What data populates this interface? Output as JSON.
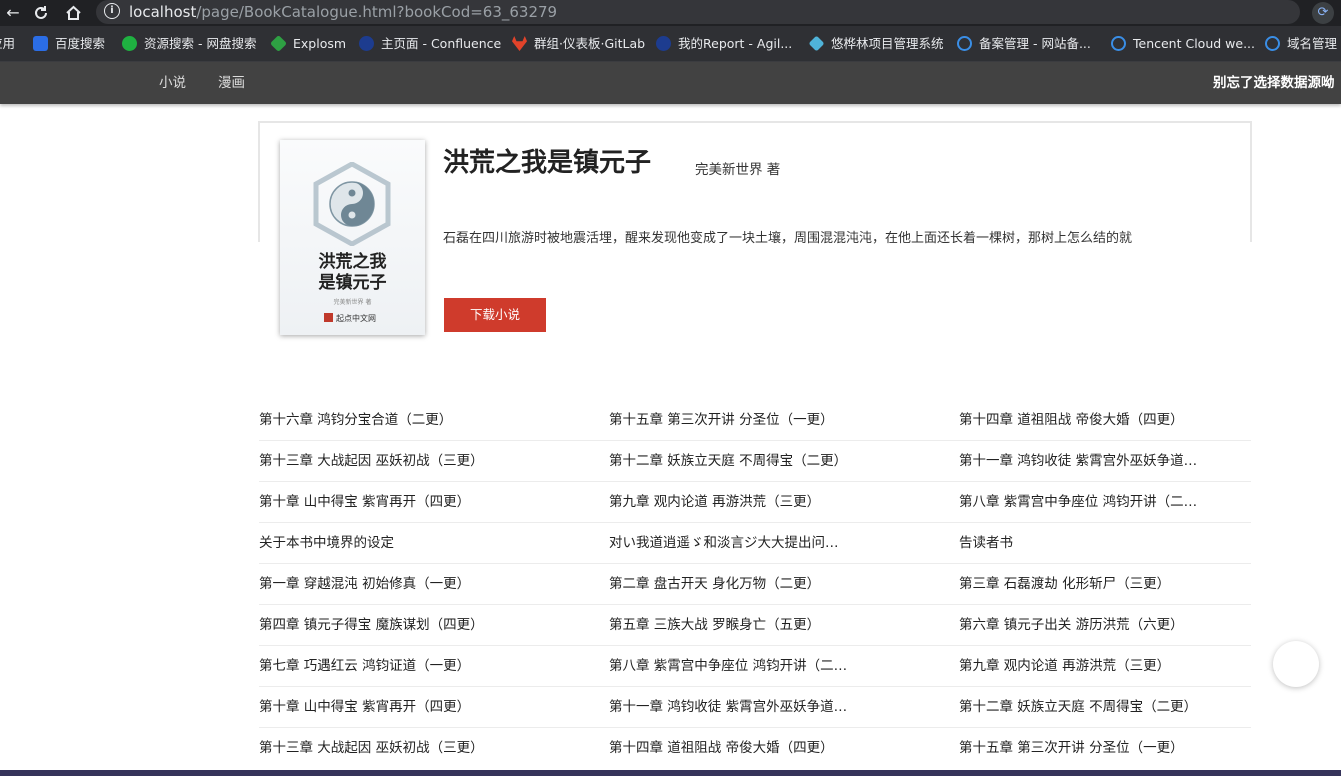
{
  "browser": {
    "url_host": "localhost",
    "url_path": "/page/BookCatalogue.html?bookCod=63_63279",
    "back_icon": "arrow-left-icon",
    "reload_icon": "reload-icon",
    "home_icon": "home-icon",
    "star_icon": "star-icon"
  },
  "bookmarks": [
    {
      "label": "应用",
      "color": "#4285f4"
    },
    {
      "label": "百度搜索",
      "color": "#2b6de5"
    },
    {
      "label": "资源搜索 - 网盘搜索",
      "color": "#1fb141"
    },
    {
      "label": "Explosm",
      "color": "#2ea043"
    },
    {
      "label": "主页面 - Confluence",
      "color": "#1d3c8f"
    },
    {
      "label": "群组·仪表板·GitLab",
      "color": "#e2432a"
    },
    {
      "label": "我的Report - Agil...",
      "color": "#1d3c8f"
    },
    {
      "label": "悠桦林项目管理系统",
      "color": "#4fb3d9"
    },
    {
      "label": "备案管理 - 网站备...",
      "color": "#3a8ee6"
    },
    {
      "label": "Tencent Cloud we...",
      "color": "#3a8ee6"
    },
    {
      "label": "域名管理",
      "color": "#3a8ee6"
    }
  ],
  "site_nav": {
    "links": [
      "小说",
      "漫画"
    ],
    "hint": "别忘了选择数据源呦"
  },
  "book": {
    "title": "洪荒之我是镇元子",
    "author": "完美新世界 著",
    "description": "石磊在四川旅游时被地震活埋，醒来发现他变成了一块土壤，周围混混沌沌，在他上面还长着一棵树，那树上怎么结的就",
    "download_label": "下载小说",
    "cover": {
      "title_line1": "洪荒之我",
      "title_line2": "是镇元子",
      "author": "完美新世界 著",
      "publisher": "起点中文网"
    }
  },
  "chapters": [
    [
      "第十六章 鸿钧分宝合道（二更）",
      "第十五章 第三次开讲 分圣位（一更）",
      "第十四章 道祖阻战 帝俊大婚（四更）"
    ],
    [
      "第十三章 大战起因 巫妖初战（三更）",
      "第十二章 妖族立天庭 不周得宝（二更）",
      "第十一章 鸿钧收徒 紫霄宫外巫妖争道（一更）"
    ],
    [
      "第十章 山中得宝 紫宵再开（四更）",
      "第九章 观内论道 再游洪荒（三更）",
      "第八章 紫霄宫中争座位 鸿钧开讲（二更）"
    ],
    [
      "关于本书中境界的设定",
      "对い我道逍遥ゞ和淡言ジ大大提出问题的回答",
      "告读者书"
    ],
    [
      "第一章 穿越混沌 初始修真（一更）",
      "第二章 盘古开天 身化万物（二更）",
      "第三章 石磊渡劫 化形斩尸（三更）"
    ],
    [
      "第四章 镇元子得宝 魔族谋划（四更）",
      "第五章 三族大战 罗睺身亡（五更）",
      "第六章 镇元子出关 游历洪荒（六更）"
    ],
    [
      "第七章 巧遇红云 鸿钧证道（一更）",
      "第八章 紫霄宫中争座位 鸿钧开讲（二更）",
      "第九章 观内论道 再游洪荒（三更）"
    ],
    [
      "第十章 山中得宝 紫宵再开（四更）",
      "第十一章 鸿钧收徒 紫霄宫外巫妖争道（一更）",
      "第十二章 妖族立天庭 不周得宝（二更）"
    ],
    [
      "第十三章 大战起因 巫妖初战（三更）",
      "第十四章 道祖阻战 帝俊大婚（四更）",
      "第十五章 第三次开讲 分圣位（一更）"
    ]
  ]
}
